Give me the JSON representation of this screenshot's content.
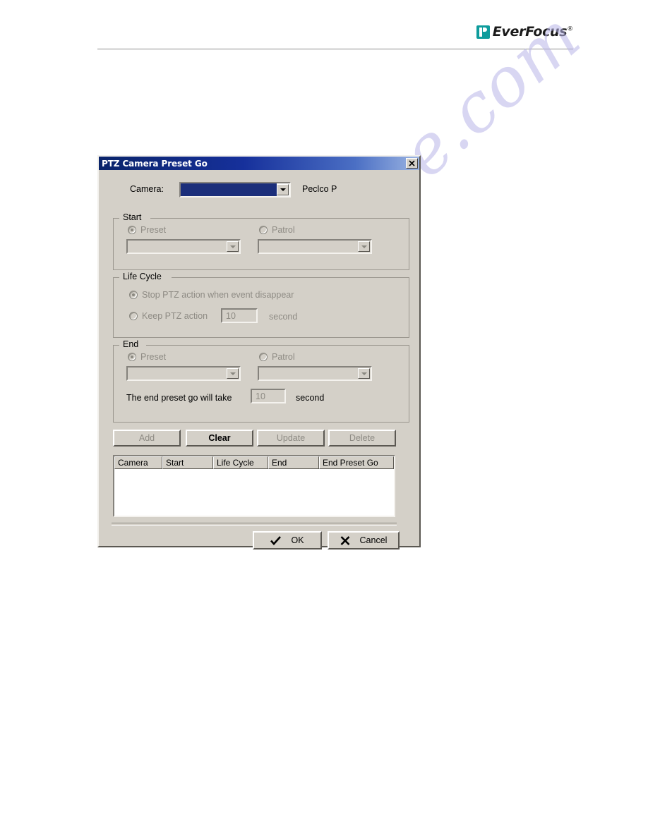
{
  "page": {
    "brand": {
      "name": "EverFocus",
      "registered": "®",
      "logo_color": "#0e9c9c"
    },
    "watermark": "manualshive.com"
  },
  "dialog": {
    "title": "PTZ Camera Preset Go",
    "close_label": "✕",
    "titlebar_color_start": "#0a246a",
    "titlebar_color_end": "#9bb4e2",
    "face_color": "#d4d0c8",
    "camera": {
      "label": "Camera:",
      "selected_value": "",
      "field_color": "#1b2e7a",
      "protocol": "Peclco P"
    },
    "start_group": {
      "legend": "Start",
      "preset_label": "Preset",
      "preset_selected": true,
      "preset_value": "",
      "patrol_label": "Patrol",
      "patrol_selected": false,
      "patrol_value": ""
    },
    "life_cycle_group": {
      "legend": "Life Cycle",
      "stop_label": "Stop PTZ action when event disappear",
      "stop_selected": true,
      "keep_label": "Keep PTZ action",
      "keep_selected": false,
      "keep_value": "10",
      "second_label": "second"
    },
    "end_group": {
      "legend": "End",
      "preset_label": "Preset",
      "preset_selected": true,
      "preset_value": "",
      "patrol_label": "Patrol",
      "patrol_selected": false,
      "patrol_value": "",
      "take_label": "The end preset go will take",
      "take_value": "10",
      "second_label": "second"
    },
    "actions": {
      "add": "Add",
      "clear": "Clear",
      "update": "Update",
      "delete": "Delete"
    },
    "table": {
      "columns": [
        "Camera",
        "Start",
        "Life Cycle",
        "End",
        "End Preset Go"
      ],
      "rows": []
    },
    "footer": {
      "ok": "OK",
      "cancel": "Cancel",
      "ok_icon": "check-icon",
      "cancel_icon": "cross-icon"
    }
  }
}
